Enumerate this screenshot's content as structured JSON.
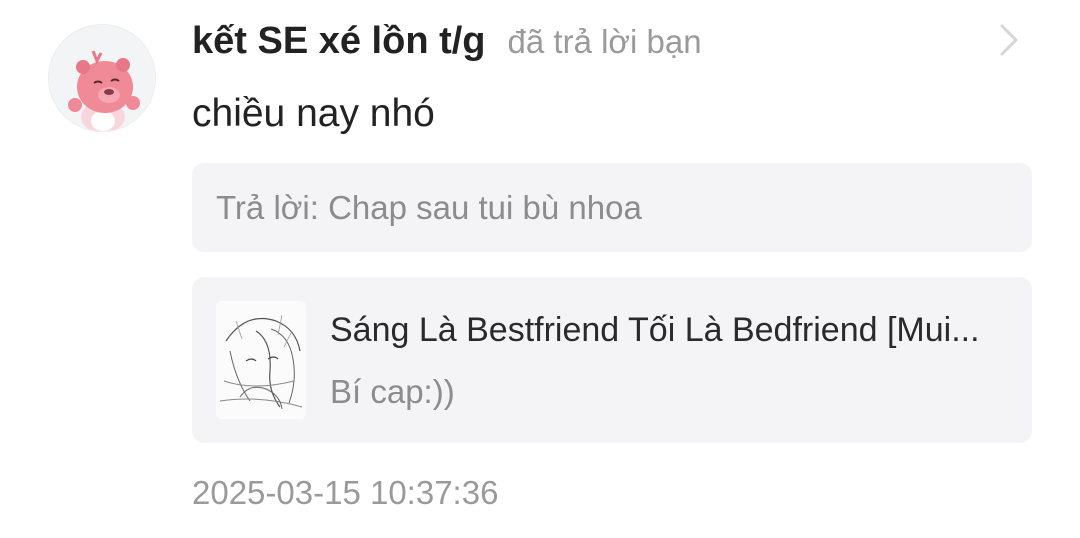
{
  "notification": {
    "user": {
      "name": "kết SE xé lồn t/g",
      "avatar_icon": "pink-beaver-avatar-icon"
    },
    "action_text": "đã trả lời bạn",
    "message": "chiều nay nhó",
    "quoted_reply": "Trả lời: Chap sau tui bù nhoa",
    "story": {
      "title": "Sáng Là Bestfriend Tối Là Bedfriend [Mui...",
      "subtitle": "Bí cap:))",
      "cover_icon": "manga-cover-thumbnail"
    },
    "timestamp": "2025-03-15 10:37:36",
    "open_icon": "chevron-right-icon"
  },
  "colors": {
    "background": "#ffffff",
    "card_background": "#f4f4f6",
    "primary_text": "#222222",
    "secondary_text": "#9a9a9a",
    "avatar_pink": "#f08a96"
  }
}
